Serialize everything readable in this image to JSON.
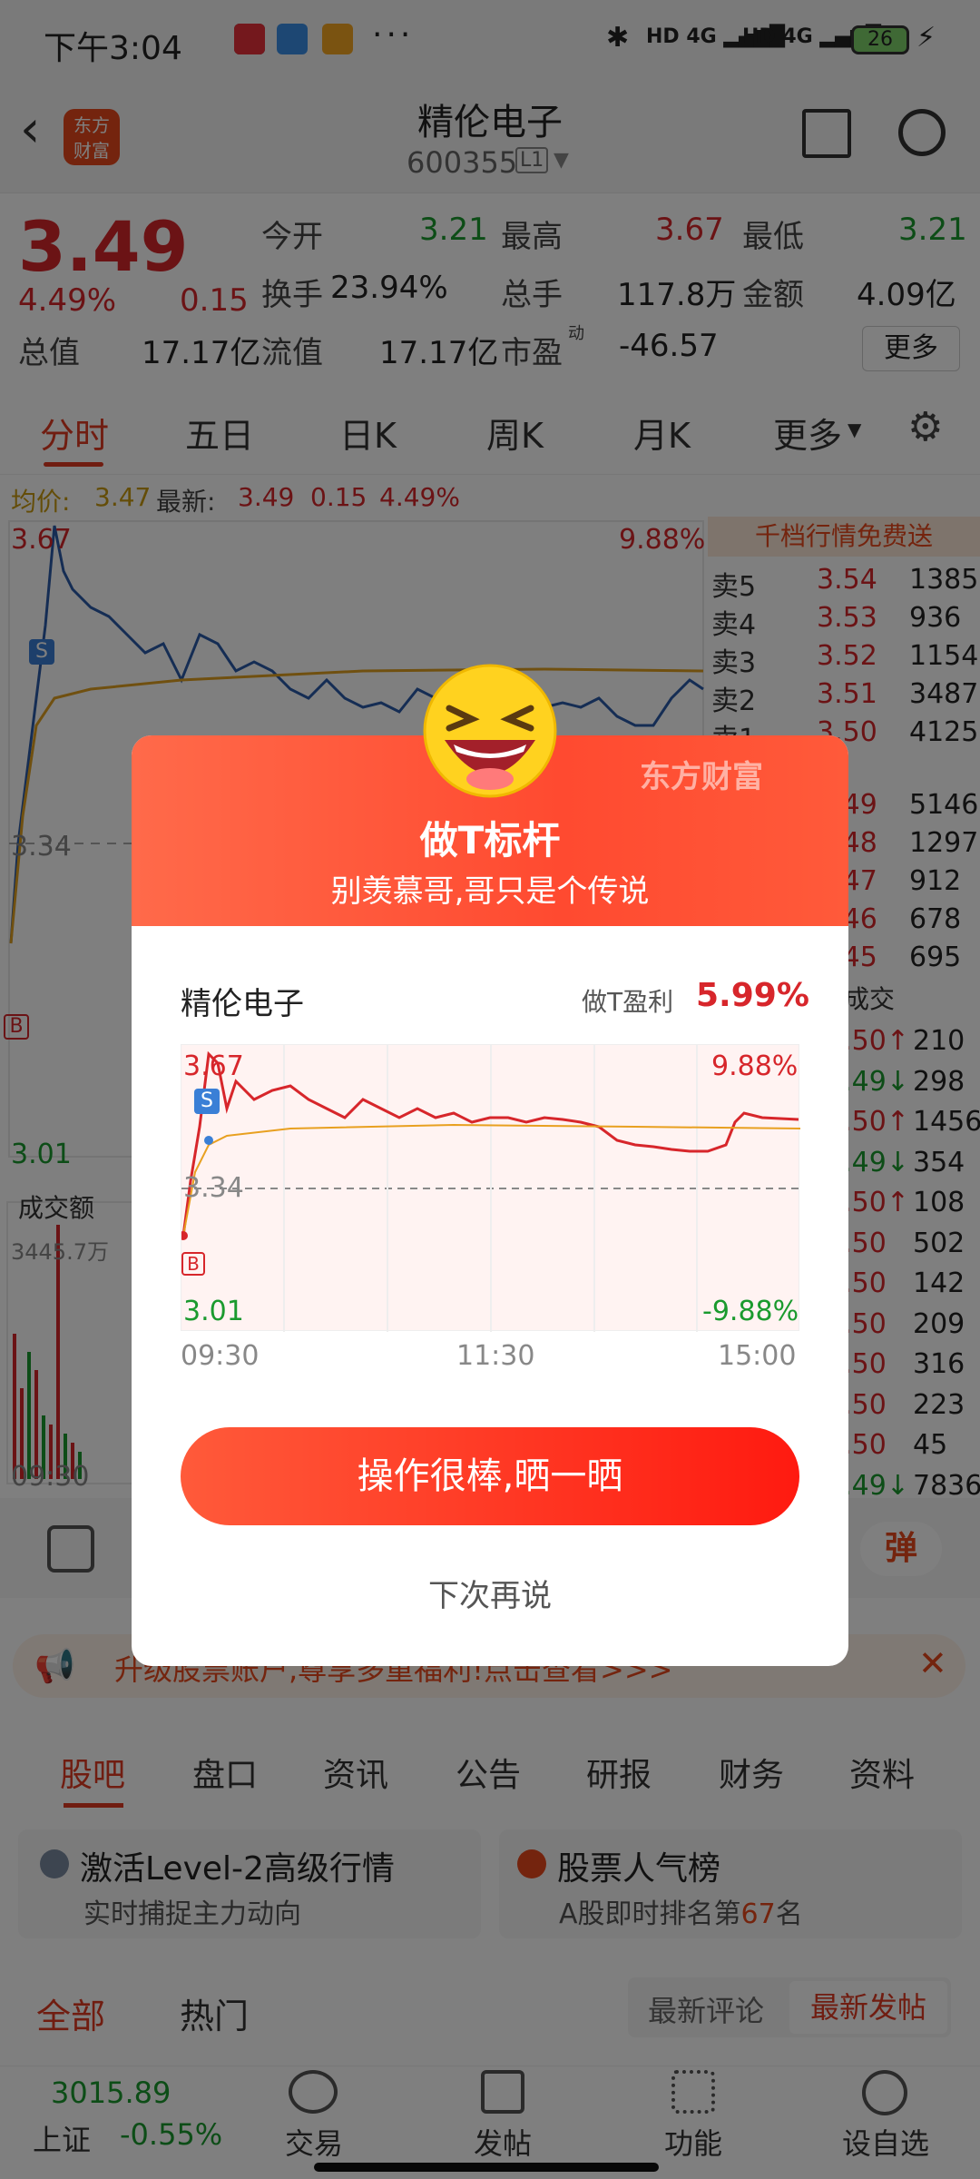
{
  "status": {
    "time": "下午3:04",
    "battery": "26"
  },
  "header": {
    "title": "精伦电子",
    "code": "600355",
    "level": "L1"
  },
  "quote": {
    "price": "3.49",
    "pct": "4.49%",
    "change": "0.15",
    "open_label": "今开",
    "open": "3.21",
    "high_label": "最高",
    "high": "3.67",
    "low_label": "最低",
    "low": "3.21",
    "turnover_label": "换手",
    "turnover": "23.94%",
    "volume_label": "总手",
    "volume": "117.8万",
    "amount_label": "金额",
    "amount": "4.09亿",
    "mktcap_label": "总值",
    "mktcap": "17.17亿",
    "float_label": "流值",
    "float": "17.17亿",
    "pe_label": "市盈",
    "pe_sup": "动",
    "pe": "-46.57",
    "more_label": "更多"
  },
  "tabs": [
    "分时",
    "五日",
    "日K",
    "周K",
    "月K",
    "更多"
  ],
  "avgline": {
    "avg_label": "均价:",
    "avg": "3.47",
    "latest_label": "最新:",
    "latest": "3.49",
    "chg": "0.15",
    "pct": "4.49%"
  },
  "chart": {
    "top": "3.67",
    "mid": "3.34",
    "bottom": "3.01",
    "pct_top": "9.88%",
    "vol_label": "成交额",
    "vol_value": "3445.7万",
    "time_start": "09:30"
  },
  "orderbook": {
    "banner": "千档行情免费送",
    "asks": [
      {
        "label": "卖5",
        "price": "3.54",
        "vol": "1385"
      },
      {
        "label": "卖4",
        "price": "3.53",
        "vol": "936"
      },
      {
        "label": "卖3",
        "price": "3.52",
        "vol": "1154"
      },
      {
        "label": "卖2",
        "price": "3.51",
        "vol": "3487"
      },
      {
        "label": "卖1",
        "price": "3.50",
        "vol": "4125"
      }
    ],
    "bids": [
      {
        "price": "3.49",
        "vol": "5146"
      },
      {
        "price": "3.48",
        "vol": "1297"
      },
      {
        "price": "3.47",
        "vol": "912"
      },
      {
        "price": "3.46",
        "vol": "678"
      },
      {
        "price": "3.45",
        "vol": "695"
      }
    ],
    "trades_label": "成交",
    "trades": [
      {
        "price": "3.50↑",
        "vol": "210"
      },
      {
        "price": "3.49↓",
        "vol": "298"
      },
      {
        "price": "3.50↑",
        "vol": "1456"
      },
      {
        "price": "3.49↓",
        "vol": "354"
      },
      {
        "price": "3.50↑",
        "vol": "108"
      },
      {
        "price": "3.50",
        "vol": "502"
      },
      {
        "price": "3.50",
        "vol": "142"
      },
      {
        "price": "3.50",
        "vol": "209"
      },
      {
        "price": "3.50",
        "vol": "316"
      },
      {
        "price": "3.50",
        "vol": "223"
      },
      {
        "price": "3.50",
        "vol": "45"
      },
      {
        "price": "3.49↓",
        "vol": "7836"
      }
    ]
  },
  "promo": {
    "text": "升级股票账户,尊享多重福利!点击查看>>>"
  },
  "section_tabs": [
    "股吧",
    "盘口",
    "资讯",
    "公告",
    "研报",
    "财务",
    "资料"
  ],
  "cards": [
    {
      "title": "激活Level-2高级行情",
      "sub": "实时捕捉主力动向"
    },
    {
      "title": "股票人气榜",
      "sub_prefix": "A股即时排名第",
      "rank": "67",
      "sub_suffix": "名"
    }
  ],
  "filter": {
    "all": "全部",
    "hot": "热门",
    "latest_comment": "最新评论",
    "latest_post": "最新发帖"
  },
  "bottom_nav": {
    "index_value": "3015.89",
    "index_name": "上证",
    "index_pct": "-0.55%",
    "trade": "交易",
    "post": "发帖",
    "func": "功能",
    "setting": "设自选",
    "danmaku": "弹"
  },
  "modal": {
    "brand": "东方财富",
    "title": "做T标杆",
    "subtitle": "别羡慕哥,哥只是个传说",
    "stock": "精伦电子",
    "profit_label": "做T盈利",
    "profit": "5.99%",
    "chart_top": "3.67",
    "chart_mid": "3.34",
    "chart_bottom": "3.01",
    "pct_top": "9.88%",
    "pct_bottom": "-9.88%",
    "t1": "09:30",
    "t2": "11:30",
    "t3": "15:00",
    "share_button": "操作很棒,晒一晒",
    "later": "下次再说"
  },
  "colors": {
    "up": "#d7262b",
    "down": "#1a9a2e",
    "accent": "#ff4a30"
  }
}
